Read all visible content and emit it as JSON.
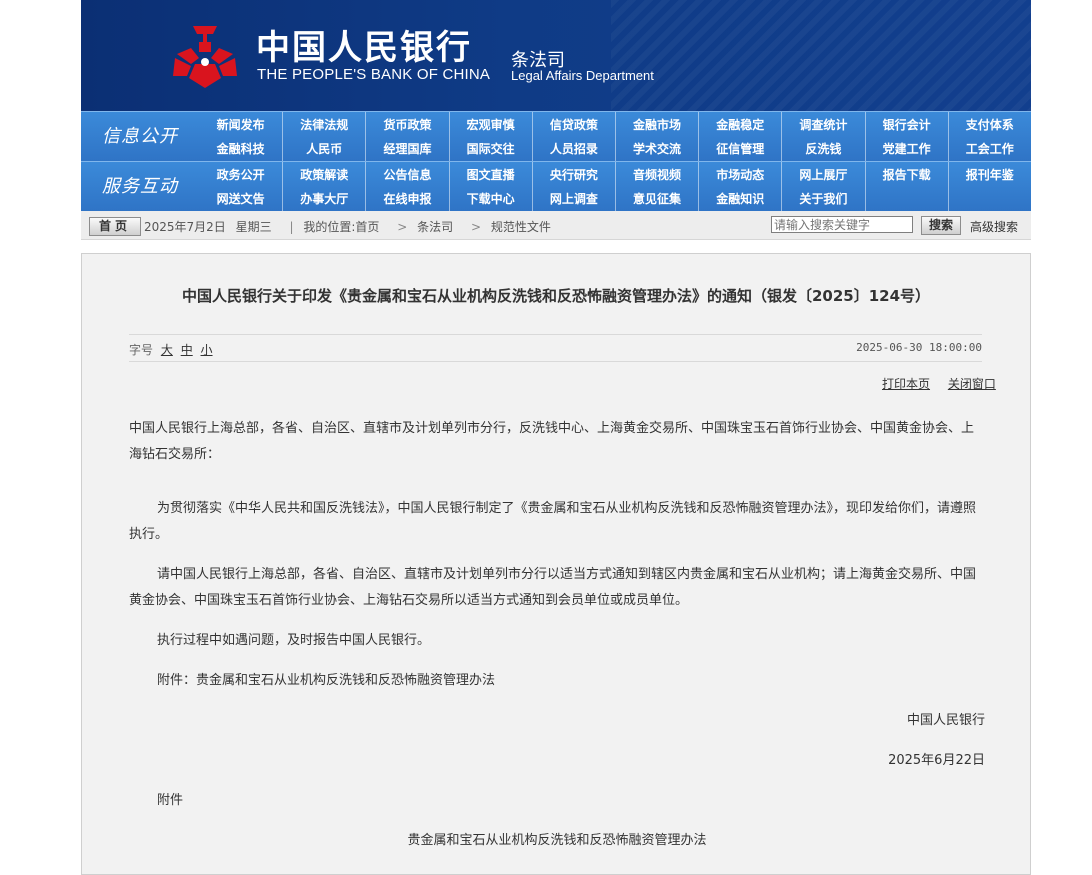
{
  "header": {
    "bank_cn": "中国人民银行",
    "bank_en": "THE PEOPLE'S BANK OF CHINA",
    "dept_cn": "条法司",
    "dept_en": "Legal Affairs Department",
    "logo_icon": "pboc-logo-icon",
    "colors": {
      "header_bg": "#0f3b86",
      "logo_red": "#d9141e",
      "nav_blue": "#3380cf"
    }
  },
  "nav": {
    "groups": [
      {
        "title": "信息公开",
        "items": [
          "新闻发布",
          "法律法规",
          "货币政策",
          "宏观审慎",
          "信贷政策",
          "金融市场",
          "金融稳定",
          "调查统计",
          "银行会计",
          "支付体系",
          "金融科技",
          "人民币",
          "经理国库",
          "国际交往",
          "人员招录",
          "学术交流",
          "征信管理",
          "反洗钱",
          "党建工作",
          "工会工作"
        ]
      },
      {
        "title": "服务互动",
        "items": [
          "政务公开",
          "政策解读",
          "公告信息",
          "图文直播",
          "央行研究",
          "音频视频",
          "市场动态",
          "网上展厅",
          "报告下载",
          "报刊年鉴",
          "网送文告",
          "办事大厅",
          "在线申报",
          "下载中心",
          "网上调查",
          "意见征集",
          "金融知识",
          "关于我们",
          "",
          ""
        ]
      }
    ]
  },
  "crumb": {
    "home": "首页",
    "date": "2025年7月2日",
    "weekday": "星期三",
    "location_label": "我的位置:首页",
    "path": [
      "条法司",
      "规范性文件"
    ],
    "search_placeholder": "请输入搜索关键字",
    "search_button": "搜索",
    "advanced_search": "高级搜索"
  },
  "article": {
    "title": "中国人民银行关于印发《贵金属和宝石从业机构反洗钱和反恐怖融资管理办法》的通知（银发〔2025〕124号）",
    "font_label": "字号",
    "font_sizes": [
      "大",
      "中",
      "小"
    ],
    "published": "2025-06-30 18:00:00",
    "print": "打印本页",
    "close": "关闭窗口",
    "addressee": "中国人民银行上海总部，各省、自治区、直辖市及计划单列市分行，反洗钱中心、上海黄金交易所、中国珠宝玉石首饰行业协会、中国黄金协会、上海钻石交易所：",
    "paragraphs": [
      "为贯彻落实《中华人民共和国反洗钱法》，中国人民银行制定了《贵金属和宝石从业机构反洗钱和反恐怖融资管理办法》，现印发给你们，请遵照执行。",
      "请中国人民银行上海总部，各省、自治区、直辖市及计划单列市分行以适当方式通知到辖区内贵金属和宝石从业机构；请上海黄金交易所、中国黄金协会、中国珠宝玉石首饰行业协会、上海钻石交易所以适当方式通知到会员单位或成员单位。",
      "执行过程中如遇问题，及时报告中国人民银行。",
      "附件：贵金属和宝石从业机构反洗钱和反恐怖融资管理办法"
    ],
    "signature": "中国人民银行",
    "date": "2025年6月22日",
    "attachment_label": "附件",
    "attachment_title": "贵金属和宝石从业机构反洗钱和反恐怖融资管理办法"
  }
}
